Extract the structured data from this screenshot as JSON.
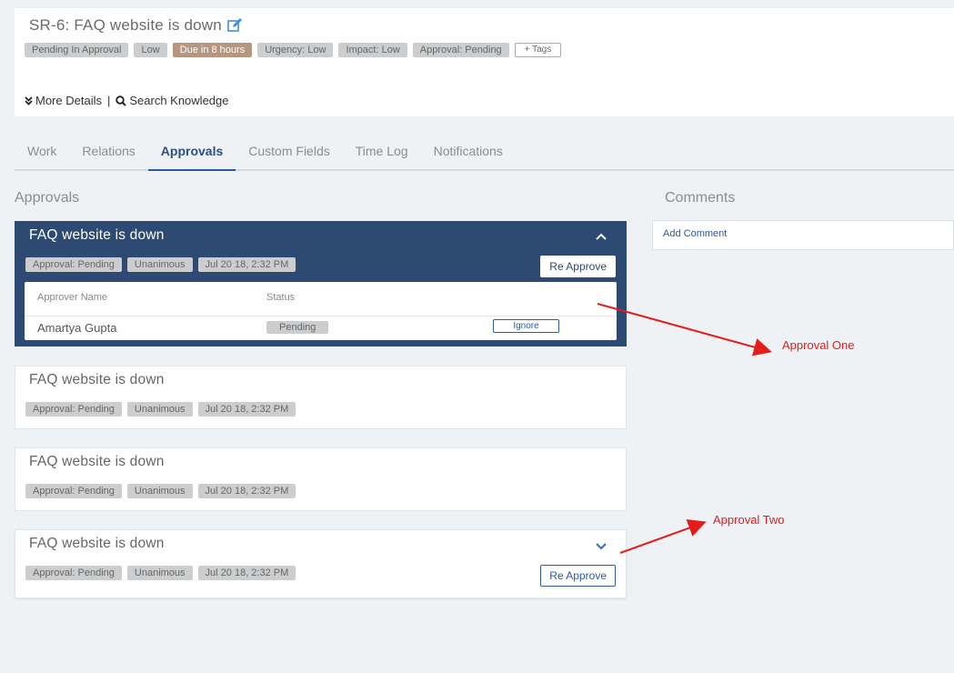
{
  "ticket": {
    "title": "SR-6: FAQ website is down",
    "tags": [
      "Pending In Approval",
      "Low",
      "Due in 8 hours",
      "Urgency: Low",
      "Impact: Low",
      "Approval: Pending"
    ],
    "add_tag_label": "+ Tags",
    "more_details": "More Details",
    "search_knowledge": "Search Knowledge"
  },
  "tabs": [
    "Work",
    "Relations",
    "Approvals",
    "Custom Fields",
    "Time Log",
    "Notifications"
  ],
  "approvals": {
    "heading": "Approvals",
    "cards": [
      {
        "title": "FAQ website is down",
        "tags": [
          "Approval: Pending",
          "Unanimous",
          "Jul 20 18, 2:32 PM"
        ],
        "reapprove": "Re Approve"
      },
      {
        "title": "FAQ website is down",
        "tags": [
          "Approval: Pending",
          "Unanimous",
          "Jul 20 18, 2:32 PM"
        ]
      },
      {
        "title": "FAQ website is down",
        "tags": [
          "Approval: Pending",
          "Unanimous",
          "Jul 20 18, 2:32 PM"
        ]
      },
      {
        "title": "FAQ website is down",
        "tags": [
          "Approval: Pending",
          "Unanimous",
          "Jul 20 18, 2:32 PM"
        ],
        "reapprove": "Re Approve"
      }
    ],
    "table": {
      "col_name": "Approver Name",
      "col_status": "Status",
      "rows": [
        {
          "name": "Amartya Gupta",
          "status": "Pending",
          "action": "Ignore"
        }
      ]
    }
  },
  "comments": {
    "heading": "Comments",
    "add_comment": "Add Comment"
  },
  "annotations": {
    "one": "Approval One",
    "two": "Approval Two"
  },
  "colors": {
    "accent": "#2d4a72",
    "annotation": "#e51c1c",
    "due_tag": "#b79680"
  }
}
